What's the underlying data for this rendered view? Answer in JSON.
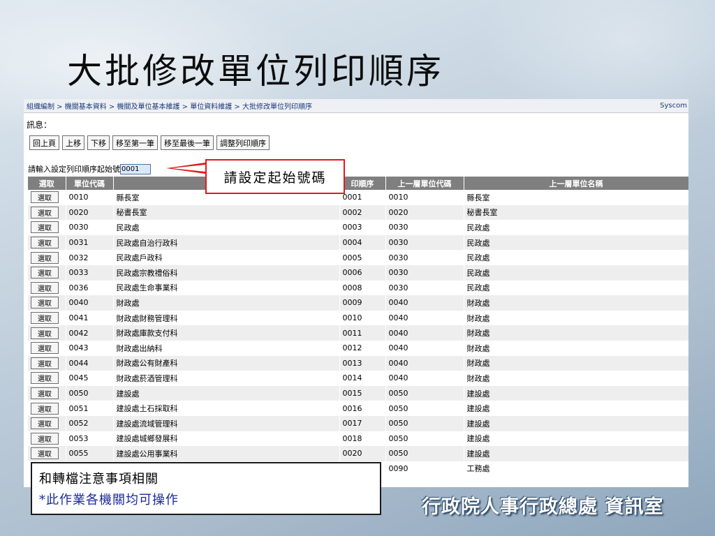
{
  "slide_title": "大批修改單位列印順序",
  "breadcrumb": "組織編制 > 機關基本資料 > 機關及單位基本維護 > 單位資料維護 > 大批修改單位列印順序",
  "brand_short": "Syscom",
  "message_label": "訊息：",
  "toolbar": {
    "back": "回上頁",
    "move_up": "上移",
    "move_down": "下移",
    "move_first": "移至第一筆",
    "move_last": "移至最後一筆",
    "adjust_order": "調整列印順序"
  },
  "start_number": {
    "label": "請輸入設定列印順序起始號",
    "value": "0001"
  },
  "table": {
    "headers": [
      "選取",
      "單位代碼",
      "",
      "印順序",
      "上一層單位代碼",
      "上一層單位名稱"
    ],
    "select_label": "選取",
    "rows": [
      [
        "0010",
        "縣長室",
        "0001",
        "0010",
        "縣長室"
      ],
      [
        "0020",
        "秘書長室",
        "0002",
        "0020",
        "秘書長室"
      ],
      [
        "0030",
        "民政處",
        "0003",
        "0030",
        "民政處"
      ],
      [
        "0031",
        "民政處自治行政科",
        "0004",
        "0030",
        "民政處"
      ],
      [
        "0032",
        "民政處戶政科",
        "0005",
        "0030",
        "民政處"
      ],
      [
        "0033",
        "民政處宗教禮俗科",
        "0006",
        "0030",
        "民政處"
      ],
      [
        "0036",
        "民政處生命事業科",
        "0008",
        "0030",
        "民政處"
      ],
      [
        "0040",
        "財政處",
        "0009",
        "0040",
        "財政處"
      ],
      [
        "0041",
        "財政處財務管理科",
        "0010",
        "0040",
        "財政處"
      ],
      [
        "0042",
        "財政處庫款支付科",
        "0011",
        "0040",
        "財政處"
      ],
      [
        "0043",
        "財政處出納科",
        "0012",
        "0040",
        "財政處"
      ],
      [
        "0044",
        "財政處公有財產科",
        "0013",
        "0040",
        "財政處"
      ],
      [
        "0045",
        "財政處菸酒管理科",
        "0014",
        "0040",
        "財政處"
      ],
      [
        "0050",
        "建設處",
        "0015",
        "0050",
        "建設處"
      ],
      [
        "0051",
        "建設處土石採取科",
        "0016",
        "0050",
        "建設處"
      ],
      [
        "0052",
        "建設處流域管理科",
        "0017",
        "0050",
        "建設處"
      ],
      [
        "0053",
        "建設處城鄉發展科",
        "0018",
        "0050",
        "建設處"
      ],
      [
        "0055",
        "建設處公用事業科",
        "0020",
        "0050",
        "建設處"
      ],
      [
        "",
        "",
        "",
        "0090",
        "工務處"
      ]
    ]
  },
  "callout": "請設定起始號碼",
  "note": {
    "line1": "和轉檔注意事項相關",
    "line2": "*此作業各機關均可操作"
  },
  "footer_brand": "行政院人事行政總處 資訊室",
  "colors": {
    "header_gray": "#7f7f7f",
    "callout_red": "#e01b1b",
    "note_blue": "#1a2a9a"
  }
}
